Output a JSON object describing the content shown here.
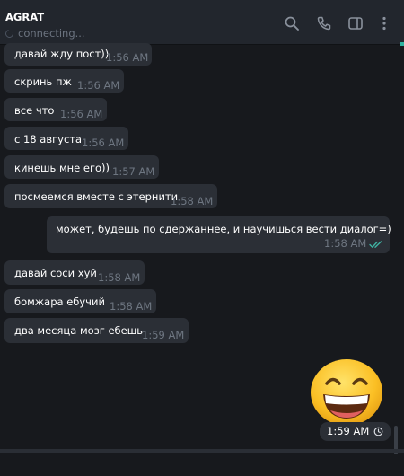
{
  "header": {
    "name": "AGRAT",
    "status": "connecting..."
  },
  "messages": [
    {
      "text": "давай жду пост))",
      "time": "1:56 AM",
      "dir": "in"
    },
    {
      "text": "скринь пж",
      "time": "1:56 AM",
      "dir": "in"
    },
    {
      "text": "все что",
      "time": "1:56 AM",
      "dir": "in"
    },
    {
      "text": "с 18 августа",
      "time": "1:56 AM",
      "dir": "in"
    },
    {
      "text": "кинешь мне его))",
      "time": "1:57 AM",
      "dir": "in"
    },
    {
      "text": "посмеемся вместе с этернити",
      "time": "1:58 AM",
      "dir": "in"
    },
    {
      "text": "может, будешь по сдержаннее, и научишься вести диалог=)",
      "time": "1:58 AM",
      "dir": "out",
      "read": true
    },
    {
      "text": "давай соси хуй",
      "time": "1:58 AM",
      "dir": "in"
    },
    {
      "text": "бомжара ебучий",
      "time": "1:58 AM",
      "dir": "in"
    },
    {
      "text": "два месяца мозг ебешь",
      "time": "1:59 AM",
      "dir": "in"
    }
  ],
  "sticker": {
    "emoji": "grinning-face-with-smiling-eyes",
    "time": "1:59 AM"
  },
  "colors": {
    "background": "#17191d",
    "header": "#22262d",
    "bubble": "#2b2f36",
    "time": "#6e7681",
    "read_check": "#3fb3a3",
    "accent": "#2fb3a0"
  }
}
